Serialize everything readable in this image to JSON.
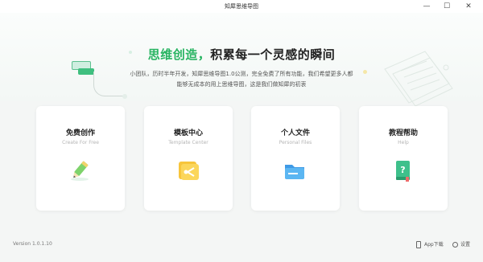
{
  "window": {
    "title": "知犀思维导图",
    "minimize_glyph": "—",
    "maximize_glyph": "☐",
    "close_glyph": "✕"
  },
  "hero": {
    "headline_green": "思维创造，",
    "headline_dark": "积累每一个灵感的瞬间",
    "subtext": "小团队，历时半年开发，知犀思维导图1.0公测，完全免费了所有功能，我们希望更多人都能够无成本的用上思维导图，这是我们做知犀的初衷"
  },
  "cards": [
    {
      "title": "免费创作",
      "subtitle": "Create For Free",
      "icon": "pencil-icon"
    },
    {
      "title": "模板中心",
      "subtitle": "Template Center",
      "icon": "template-icon"
    },
    {
      "title": "个人文件",
      "subtitle": "Personal Files",
      "icon": "folder-icon"
    },
    {
      "title": "教程帮助",
      "subtitle": "Help",
      "icon": "help-book-icon"
    }
  ],
  "footer": {
    "version": "Version 1.0.1.10",
    "app_download": "App下载",
    "settings": "设置"
  },
  "colors": {
    "accent": "#28b462",
    "background": "#f4f6f5"
  }
}
